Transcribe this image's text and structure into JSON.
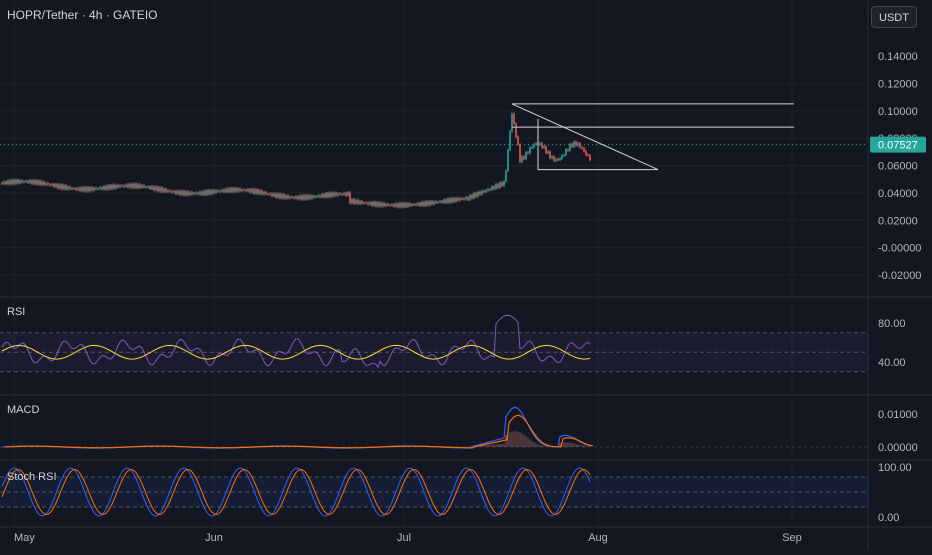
{
  "header": {
    "symbol_title": "HOPR/Tether · 4h · GATEIO",
    "currency_button": "USDT"
  },
  "price_axis": {
    "ticks": [
      "0.14000",
      "0.12000",
      "0.10000",
      "0.08000",
      "0.06000",
      "0.04000",
      "0.02000",
      "-0.00000",
      "-0.02000"
    ],
    "tick_values": [
      0.14,
      0.12,
      0.1,
      0.08,
      0.06,
      0.04,
      0.02,
      0.0,
      -0.02
    ],
    "last_price": "0.07527",
    "last_price_value": 0.07527
  },
  "panes": {
    "rsi": {
      "label": "RSI",
      "ticks": [
        "80.00",
        "40.00"
      ],
      "tick_values": [
        80,
        40
      ],
      "band_upper": 70,
      "band_mid": 50,
      "band_lower": 30
    },
    "macd": {
      "label": "MACD",
      "ticks": [
        "0.01000",
        "0.00000"
      ],
      "tick_values": [
        0.01,
        0.0
      ]
    },
    "stoch": {
      "label": "Stoch RSI",
      "ticks": [
        "100.00",
        "0.00"
      ],
      "tick_values": [
        100,
        0
      ],
      "band_upper": 80,
      "band_mid": 50,
      "band_lower": 20
    }
  },
  "time_axis": {
    "labels": [
      "May",
      "Jun",
      "Jul",
      "Aug",
      "Sep"
    ]
  },
  "colors": {
    "background": "#131722",
    "grid": "#1e222d",
    "up": "#26a69a",
    "down": "#ef5350",
    "text": "#b2b5be",
    "rsi_line": "#7e57c2",
    "rsi_ma": "#fdd835",
    "macd_line": "#2962ff",
    "macd_signal": "#ff6d00",
    "stoch_k": "#2962ff",
    "stoch_d": "#ff6d00",
    "drawing": "#d1d4dc",
    "last_price_bg": "#26a69a"
  }
}
